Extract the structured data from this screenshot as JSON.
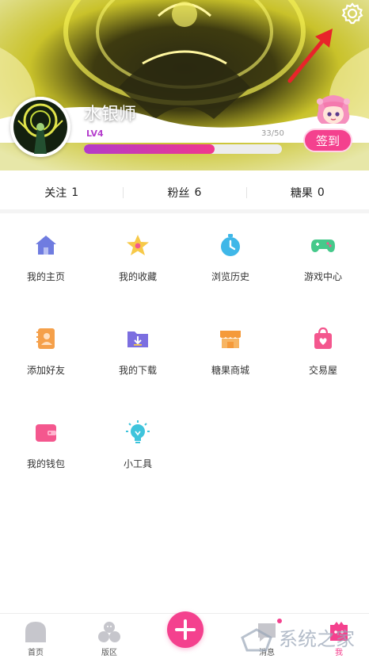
{
  "profile": {
    "username": "水银师",
    "level": "LV4",
    "exp_text": "33/50",
    "exp_progress": 0.66,
    "signin_label": "签到"
  },
  "stats": [
    {
      "label": "关注",
      "value": "1"
    },
    {
      "label": "粉丝",
      "value": "6"
    },
    {
      "label": "糖果",
      "value": "0"
    }
  ],
  "menu": [
    {
      "label": "我的主页",
      "icon": "home-icon",
      "color": "#6f7ce0"
    },
    {
      "label": "我的收藏",
      "icon": "star-icon",
      "color": "#f7c948"
    },
    {
      "label": "浏览历史",
      "icon": "clock-icon",
      "color": "#3fb7e8"
    },
    {
      "label": "游戏中心",
      "icon": "gamepad-icon",
      "color": "#45c98b"
    },
    {
      "label": "添加好友",
      "icon": "add-friend-icon",
      "color": "#f5a04a"
    },
    {
      "label": "我的下载",
      "icon": "download-folder-icon",
      "color": "#7b6ee0"
    },
    {
      "label": "糖果商城",
      "icon": "shop-icon",
      "color": "#f59a3a"
    },
    {
      "label": "交易屋",
      "icon": "shopping-bag-icon",
      "color": "#f4578e"
    },
    {
      "label": "我的钱包",
      "icon": "wallet-icon",
      "color": "#f4578e"
    },
    {
      "label": "小工具",
      "icon": "lightbulb-icon",
      "color": "#3fc4dc"
    }
  ],
  "nav": [
    {
      "label": "首页",
      "icon": "home-nav-icon"
    },
    {
      "label": "版区",
      "icon": "community-icon"
    },
    {
      "label": "",
      "icon": "plus-icon"
    },
    {
      "label": "消息",
      "icon": "message-icon"
    },
    {
      "label": "我",
      "icon": "me-icon"
    }
  ],
  "colors": {
    "accent": "#f4418e",
    "level": "#b53fcd",
    "header_bg": "#d9cf2a"
  },
  "watermark": "系统之家"
}
